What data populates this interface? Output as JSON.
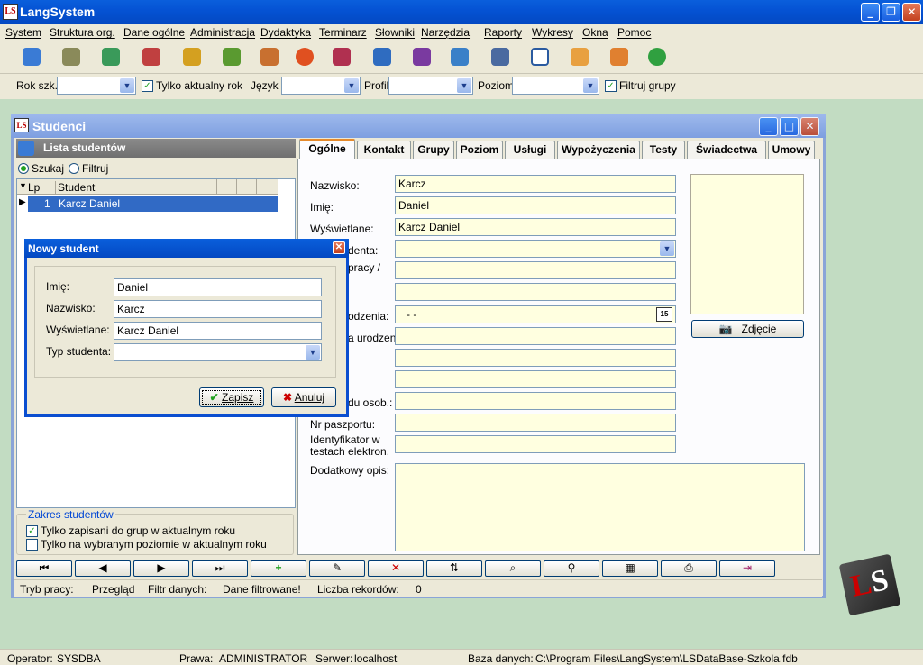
{
  "app": {
    "title": "LangSystem",
    "logo": "LS"
  },
  "menu": [
    "System",
    "Struktura org.",
    "Dane ogólne",
    "Administracja",
    "Dydaktyka",
    "Terminarz",
    "Słowniki",
    "Narzędzia",
    "Raporty",
    "Wykresy",
    "Okna",
    "Pomoc"
  ],
  "toolbar": {
    "icons": [
      "students-icon",
      "teachers-icon",
      "books-icon",
      "clients-icon",
      "schedule-icon",
      "finance-icon",
      "tasks-icon",
      "cd-icon",
      "library-icon",
      "documents-icon",
      "catalog-icon",
      "reports-icon",
      "copy-icon",
      "windows-icon",
      "layout-icon",
      "connect-icon",
      "disconnect-icon",
      "refresh-icon"
    ]
  },
  "filterbar": {
    "rok_label": "Rok szk.",
    "tylko_aktualny": "Tylko aktualny rok",
    "jezyk_label": "Język",
    "profil_label": "Profil",
    "poziom_label": "Poziom",
    "filtruj_grupy": "Filtruj grupy"
  },
  "window": {
    "title": "Studenci"
  },
  "list": {
    "header": "Lista studentów",
    "search_label": "Szukaj",
    "filter_label": "Filtruj",
    "col_lp": "Lp",
    "col_student": "Student",
    "rows": [
      {
        "lp": "1",
        "student": "Karcz Daniel"
      }
    ],
    "range_title": "Zakres studentów",
    "range_opt1": "Tylko zapisani do grup w aktualnym roku",
    "range_opt2": "Tylko na wybranym poziomie w aktualnym roku"
  },
  "tabs": [
    "Ogólne",
    "Kontakt",
    "Grupy",
    "Poziom",
    "Usługi",
    "Wypożyczenia",
    "Testy",
    "Świadectwa",
    "Umowy"
  ],
  "form": {
    "nazwisko_label": "Nazwisko:",
    "nazwisko": "Karcz",
    "imie_label": "Imię:",
    "imie": "Daniel",
    "wyswietlane_label": "Wyświetlane:",
    "wyswietlane": "Karcz Daniel",
    "typ_label_partial": "denta:",
    "praca_label_partial": "pracy /",
    "urodzenia_label_partial": "odzenia:",
    "urodzenia_value": " - -",
    "miejsce_label_partial": "a urodzenia:",
    "dowod_label_partial": "du osob.:",
    "paszport_label": "Nr paszportu:",
    "ident_label1": "Identyfikator w",
    "ident_label2": "testach elektron.",
    "opis_label": "Dodatkowy opis:",
    "calendar_badge": "15",
    "photo_button": "Zdjęcie"
  },
  "status": {
    "tryb_label": "Tryb pracy:",
    "tryb": "Przegląd",
    "filtr_label": "Filtr danych:",
    "filtr": "Dane filtrowane!",
    "liczba_label": "Liczba rekordów:",
    "liczba": "0"
  },
  "bottom": {
    "operator_label": "Operator:",
    "operator": "SYSDBA",
    "prawa_label": "Prawa:",
    "prawa": "ADMINISTRATOR",
    "serwer_label": "Serwer:",
    "serwer": "localhost",
    "baza_label": "Baza danych:",
    "baza": "C:\\Program Files\\LangSystem\\LSDataBase-Szkola.fdb"
  },
  "dialog": {
    "title": "Nowy student",
    "imie_label": "Imię:",
    "imie": "Daniel",
    "nazwisko_label": "Nazwisko:",
    "nazwisko": "Karcz",
    "wyswietlane_label": "Wyświetlane:",
    "wyswietlane": "Karcz Daniel",
    "typ_label": "Typ studenta:",
    "save": "Zapisz",
    "cancel": "Anuluj"
  },
  "colors": {
    "xp_blue": "#0553d4",
    "desktop": "#c2dcc2",
    "field": "#ffffe0",
    "selection": "#316ac5"
  }
}
